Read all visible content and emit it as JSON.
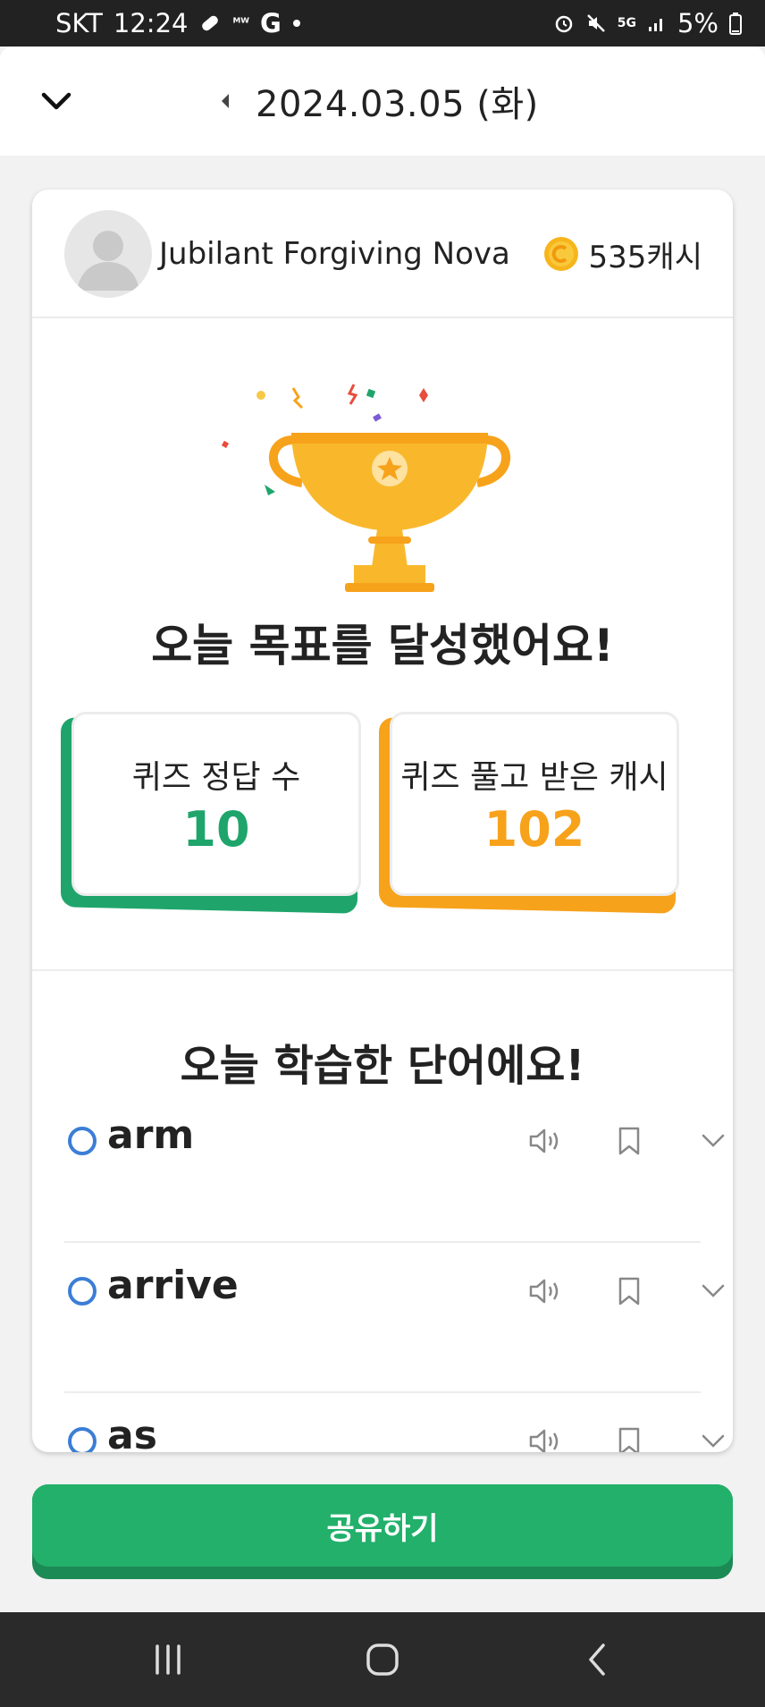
{
  "status_bar": {
    "carrier": "SKT",
    "time": "12:24",
    "network": "5G",
    "battery": "5%"
  },
  "header": {
    "date": "2024.03.05 (화)"
  },
  "profile": {
    "name": "Jubilant Forgiving Nova",
    "cash": "535캐시"
  },
  "achievement": {
    "title": "오늘 목표를 달성했어요!"
  },
  "stats": [
    {
      "label": "퀴즈 정답 수",
      "value": "10",
      "color": "#1fa56b"
    },
    {
      "label": "퀴즈 풀고 받은 캐시",
      "value": "102",
      "color": "#f7a21b"
    }
  ],
  "words": {
    "title": "오늘 학습한 단어에요!",
    "items": [
      {
        "word": "arm"
      },
      {
        "word": "arrive"
      },
      {
        "word": "as"
      }
    ]
  },
  "share": {
    "label": "공유하기"
  },
  "colors": {
    "primary_green": "#22b06b",
    "accent_orange": "#f7a21b",
    "word_ring_blue": "#3b7ed6"
  }
}
